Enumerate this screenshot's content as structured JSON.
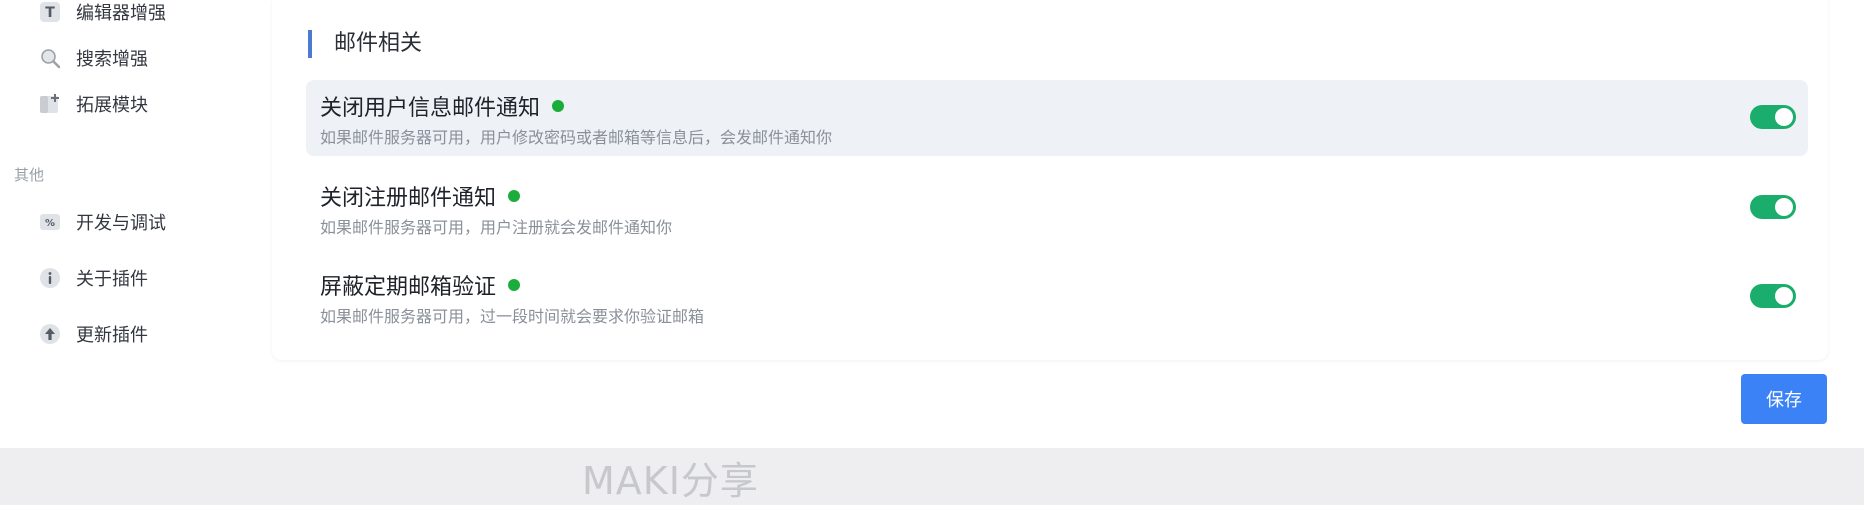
{
  "sidebar": {
    "items_top": [
      {
        "label": "编辑器增强",
        "icon": "text-format-icon"
      },
      {
        "label": "搜索增强",
        "icon": "search-icon"
      },
      {
        "label": "拓展模块",
        "icon": "extension-module-icon"
      }
    ],
    "group_other": "其他",
    "items_other": [
      {
        "label": "开发与调试",
        "icon": "dev-debug-icon"
      },
      {
        "label": "关于插件",
        "icon": "info-icon"
      },
      {
        "label": "更新插件",
        "icon": "upload-arrow-icon"
      }
    ]
  },
  "section": {
    "title": "邮件相关"
  },
  "settings": [
    {
      "title": "关闭用户信息邮件通知",
      "desc": "如果邮件服务器可用，用户修改密码或者邮箱等信息后，会发邮件通知你",
      "enabled": true
    },
    {
      "title": "关闭注册邮件通知",
      "desc": "如果邮件服务器可用，用户注册就会发邮件通知你",
      "enabled": true
    },
    {
      "title": "屏蔽定期邮箱验证",
      "desc": "如果邮件服务器可用，过一段时间就会要求你验证邮箱",
      "enabled": true
    }
  ],
  "actions": {
    "save_label": "保存"
  },
  "watermark": "MAKI分享",
  "colors": {
    "accent": "#3b82f6",
    "toggle_on": "#1aad6b",
    "status_dot": "#1aad3b",
    "section_bar": "#4a7bd0"
  }
}
